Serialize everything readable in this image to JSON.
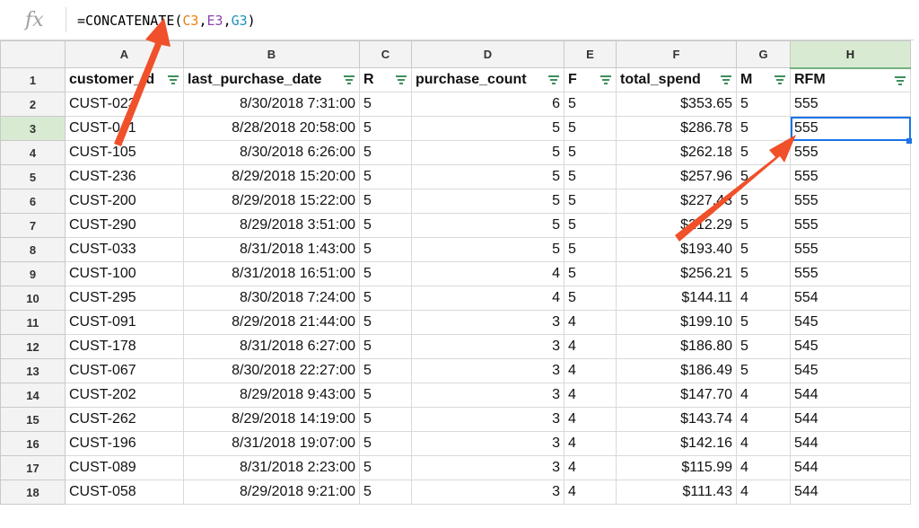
{
  "formula_bar": {
    "fx": "fx",
    "prefix": "=CONCATENATE(",
    "ref1": "C3",
    "comma1": ",",
    "ref2": "E3",
    "comma2": ",",
    "ref3": "G3",
    "suffix": ")"
  },
  "columns": [
    "A",
    "B",
    "C",
    "D",
    "E",
    "F",
    "G",
    "H"
  ],
  "selected_column": "H",
  "selected_row": "3",
  "header_row": {
    "row_number": "1",
    "cells": [
      "customer_id",
      "last_purchase_date",
      "R",
      "purchase_count",
      "F",
      "total_spend",
      "M",
      "RFM"
    ]
  },
  "rows": [
    {
      "n": "2",
      "cells": [
        "CUST-023",
        "8/30/2018 7:31:00",
        "5",
        "6",
        "5",
        "$353.65",
        "5",
        "555"
      ]
    },
    {
      "n": "3",
      "cells": [
        "CUST-041",
        "8/28/2018 20:58:00",
        "5",
        "5",
        "5",
        "$286.78",
        "5",
        "555"
      ]
    },
    {
      "n": "4",
      "cells": [
        "CUST-105",
        "8/30/2018 6:26:00",
        "5",
        "5",
        "5",
        "$262.18",
        "5",
        "555"
      ]
    },
    {
      "n": "5",
      "cells": [
        "CUST-236",
        "8/29/2018 15:20:00",
        "5",
        "5",
        "5",
        "$257.96",
        "5",
        "555"
      ]
    },
    {
      "n": "6",
      "cells": [
        "CUST-200",
        "8/29/2018 15:22:00",
        "5",
        "5",
        "5",
        "$227.43",
        "5",
        "555"
      ]
    },
    {
      "n": "7",
      "cells": [
        "CUST-290",
        "8/29/2018 3:51:00",
        "5",
        "5",
        "5",
        "$212.29",
        "5",
        "555"
      ]
    },
    {
      "n": "8",
      "cells": [
        "CUST-033",
        "8/31/2018 1:43:00",
        "5",
        "5",
        "5",
        "$193.40",
        "5",
        "555"
      ]
    },
    {
      "n": "9",
      "cells": [
        "CUST-100",
        "8/31/2018 16:51:00",
        "5",
        "4",
        "5",
        "$256.21",
        "5",
        "555"
      ]
    },
    {
      "n": "10",
      "cells": [
        "CUST-295",
        "8/30/2018 7:24:00",
        "5",
        "4",
        "5",
        "$144.11",
        "4",
        "554"
      ]
    },
    {
      "n": "11",
      "cells": [
        "CUST-091",
        "8/29/2018 21:44:00",
        "5",
        "3",
        "4",
        "$199.10",
        "5",
        "545"
      ]
    },
    {
      "n": "12",
      "cells": [
        "CUST-178",
        "8/31/2018 6:27:00",
        "5",
        "3",
        "4",
        "$186.80",
        "5",
        "545"
      ]
    },
    {
      "n": "13",
      "cells": [
        "CUST-067",
        "8/30/2018 22:27:00",
        "5",
        "3",
        "4",
        "$186.49",
        "5",
        "545"
      ]
    },
    {
      "n": "14",
      "cells": [
        "CUST-202",
        "8/29/2018 9:43:00",
        "5",
        "3",
        "4",
        "$147.70",
        "4",
        "544"
      ]
    },
    {
      "n": "15",
      "cells": [
        "CUST-262",
        "8/29/2018 14:19:00",
        "5",
        "3",
        "4",
        "$143.74",
        "4",
        "544"
      ]
    },
    {
      "n": "16",
      "cells": [
        "CUST-196",
        "8/31/2018 19:07:00",
        "5",
        "3",
        "4",
        "$142.16",
        "4",
        "544"
      ]
    },
    {
      "n": "17",
      "cells": [
        "CUST-089",
        "8/31/2018 2:23:00",
        "5",
        "3",
        "4",
        "$115.99",
        "4",
        "544"
      ]
    },
    {
      "n": "18",
      "cells": [
        "CUST-058",
        "8/29/2018 9:21:00",
        "5",
        "3",
        "4",
        "$111.43",
        "4",
        "544"
      ]
    }
  ],
  "colors": {
    "arrow": "#f0502a",
    "selection": "#1a73e8",
    "filter_icon": "#3d8f5c",
    "selected_header_bg": "#d9ead3"
  },
  "icons": [
    "fx-icon",
    "filter-icon",
    "annotation-arrow"
  ]
}
